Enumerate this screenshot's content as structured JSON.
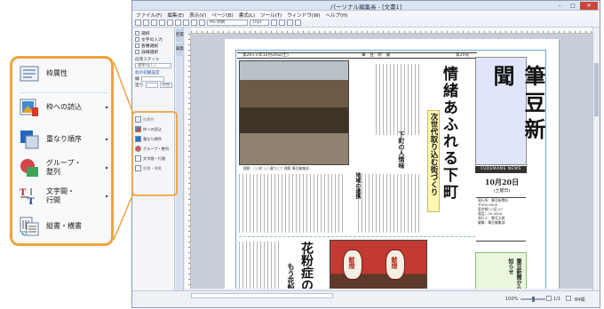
{
  "window": {
    "title": "パーソナル編集長 - [文書1]",
    "min": "–",
    "max": "□",
    "close": "✕"
  },
  "menu": [
    "ファイル(F)",
    "編集(E)",
    "表示(V)",
    "ページ(B)",
    "書式(L)",
    "ツール(T)",
    "ウィンドウ(W)",
    "ヘルプ(H)"
  ],
  "toolbar": {
    "font": "MS 明朝",
    "size": "10pt",
    "icons": [
      "new-icon",
      "open-icon",
      "save-icon",
      "print-icon",
      "cut-icon",
      "copy-icon",
      "paste-icon",
      "undo-icon",
      "redo-icon"
    ]
  },
  "left_panel": {
    "items": [
      "選択",
      "文字の入力",
      "各種選択",
      "詳細選択"
    ],
    "style_label": "段落スタイル",
    "style_value": "標準(なし)",
    "frame_label": "枠の初期設定",
    "frame_fields": [
      "線",
      "塗り"
    ],
    "frame_value": "枠色",
    "small_items": [
      "枠属性",
      "枠への読込",
      "重なり順序",
      "グループ・整列",
      "文字間・行間",
      "縦書・横書"
    ]
  },
  "side_tabs": [
    "配置",
    "編集"
  ],
  "callout": {
    "items": [
      {
        "label": "枠属性",
        "arrow": "",
        "icon": "frame-attributes-icon"
      },
      {
        "label": "枠への読込",
        "arrow": "▸",
        "icon": "load-into-frame-icon"
      },
      {
        "label": "重なり順序",
        "arrow": "▸",
        "icon": "stacking-order-icon"
      },
      {
        "label": "グループ・\n整列",
        "arrow": "▸",
        "icon": "group-align-icon"
      },
      {
        "label": "文字間・\n行間",
        "arrow": "▸",
        "icon": "char-line-spacing-icon"
      },
      {
        "label": "縦書・横書",
        "arrow": "",
        "icon": "vertical-horizontal-writing-icon"
      }
    ]
  },
  "newspaper": {
    "header_left": "第20××年10月20日(土)",
    "header_mid": "筆　豆　新　聞",
    "header_right": "第20号",
    "headline": "情緒あふれる下町",
    "subhead": "次世代取り込む街づくり",
    "h2": "下町の人情味",
    "h3": "地域の連携",
    "h4": "花粉症の",
    "h5": "もう花粉",
    "photo_caption": "撮影：○○町 ○○通りにて 撮影 筆豆編集部",
    "masthead": "筆豆新聞",
    "masthead_en": "FUDEMAME NEWS",
    "date": "10月20日",
    "weekday": "(土曜日)",
    "info_lines": [
      "発行所：筆豆新聞社",
      "〒000-0000",
      "東京都○○区○○",
      "電話：00-0000",
      "発行人：筆豆太郎",
      "編集：筆豆編集部"
    ],
    "green_head": "筆豆新聞からのお知らせ",
    "lantern1": "献燈",
    "lantern2": "献燈"
  },
  "status": {
    "zoom": "100%",
    "page": "1/1",
    "sheet": "B4縦"
  }
}
